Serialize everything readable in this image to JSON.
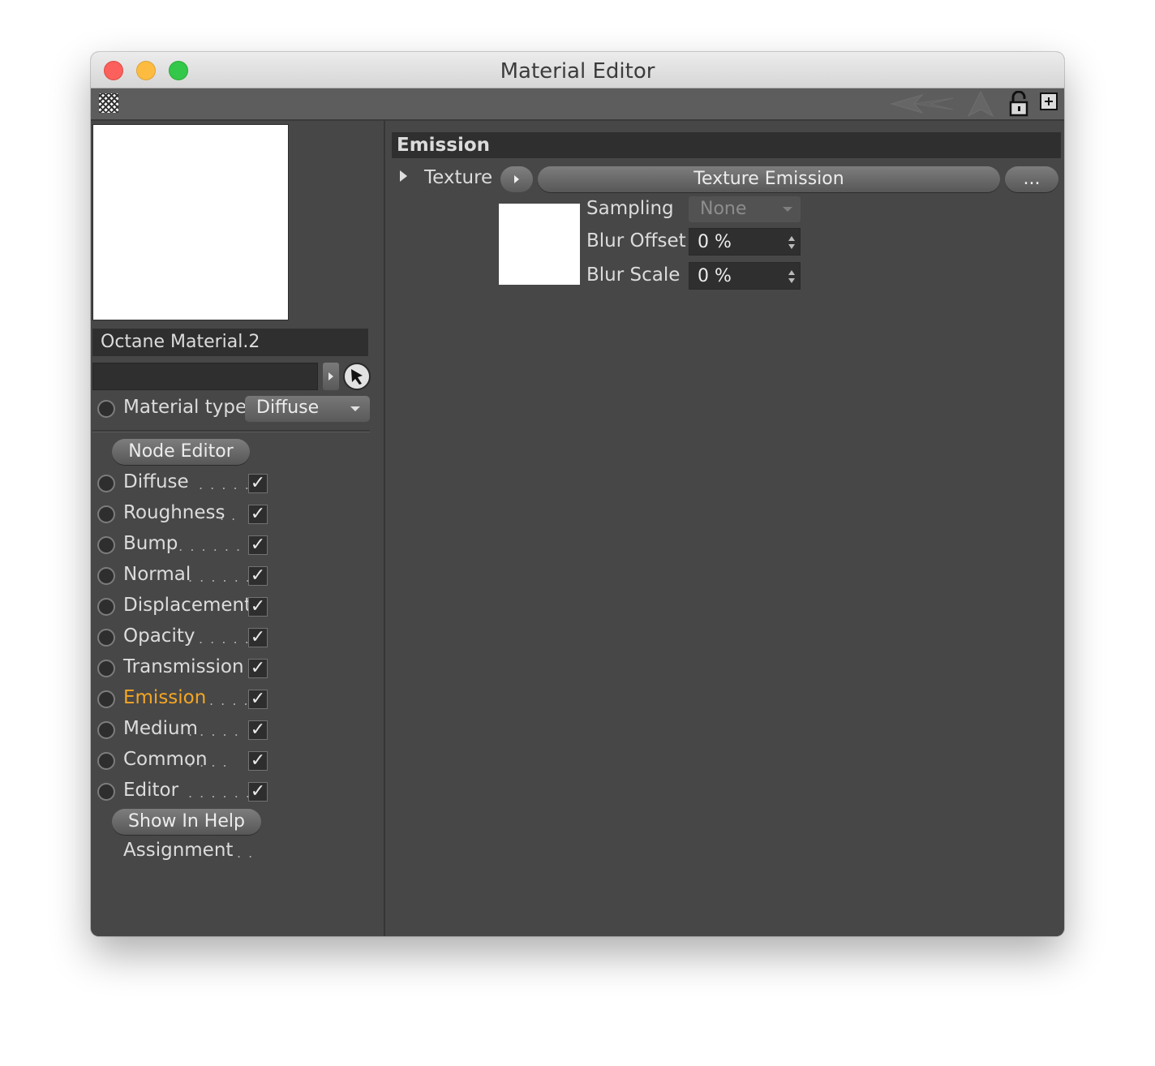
{
  "window": {
    "title": "Material Editor"
  },
  "material": {
    "name": "Octane Material.2",
    "link_value": ""
  },
  "material_type": {
    "label": "Material type",
    "value": "Diffuse"
  },
  "node_editor_label": "Node Editor",
  "channels": [
    {
      "label": "Diffuse",
      "dots": ". . . . . .",
      "checked": "✓",
      "active": false
    },
    {
      "label": "Roughness",
      "dots": ". .",
      "checked": "✓",
      "active": false
    },
    {
      "label": "Bump",
      "dots": ". . . . . . .",
      "checked": "✓",
      "active": false
    },
    {
      "label": "Normal",
      "dots": ". . . . . .",
      "checked": "✓",
      "active": false
    },
    {
      "label": "Displacement",
      "dots": "",
      "checked": "✓",
      "active": false
    },
    {
      "label": "Opacity",
      "dots": ". . . . .",
      "checked": "✓",
      "active": false
    },
    {
      "label": "Transmission",
      "dots": "",
      "checked": "✓",
      "active": false
    },
    {
      "label": "Emission",
      "dots": ". . . .",
      "checked": "✓",
      "active": true
    },
    {
      "label": "Medium",
      "dots": ". . . . .",
      "checked": "✓",
      "active": false
    },
    {
      "label": "Common",
      "dots": ". . . .",
      "checked": "✓",
      "active": false
    },
    {
      "label": "Editor",
      "dots": ". . . . . . .",
      "checked": "✓",
      "active": false
    }
  ],
  "show_in_help_label": "Show In Help",
  "assignment": {
    "label": "Assignment",
    "dots": ". ."
  },
  "emission": {
    "header": "Emission",
    "texture_label": "Texture",
    "texture_value": "Texture Emission",
    "more_label": "...",
    "sampling_label": "Sampling",
    "sampling_value": "None",
    "blur_offset_label": "Blur Offset",
    "blur_offset_value": "0 %",
    "blur_scale_label": "Blur Scale",
    "blur_scale_value": "0 %"
  },
  "colors": {
    "active_channel": "#f5a623",
    "panel_bg": "#474747",
    "field_bg": "#2f2f2f"
  }
}
